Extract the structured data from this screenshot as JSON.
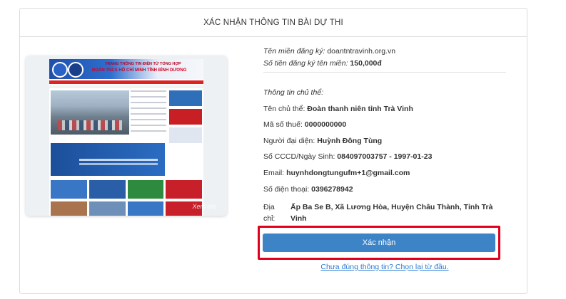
{
  "header": {
    "title": "XÁC NHẬN THÔNG TIN BÀI DỰ THI"
  },
  "preview": {
    "banner_line1": "TRANG THÔNG TIN ĐIỆN TỬ TỔNG HỢP",
    "banner_line2": "ĐOÀN TNCS HỒ CHÍ MINH TỈNH BÌNH DƯƠNG",
    "watermark": "Xem chi"
  },
  "domain": {
    "registered_label": "Tên miền đăng ký:",
    "registered_value": "doantntravinh.org.vn",
    "fee_label": "Số tiền đăng ký tên miền:",
    "fee_value": "150,000đ"
  },
  "owner": {
    "section_label": "Thông tin chủ thể:",
    "name_label": "Tên chủ thể:",
    "name_value": "Đoàn thanh niên tỉnh Trà Vinh",
    "tax_label": "Mã số thuế:",
    "tax_value": "0000000000",
    "rep_label": "Người đại diện:",
    "rep_value": "Huỳnh Đông Tùng",
    "id_label": "Số CCCD/Ngày Sinh:",
    "id_value": "084097003757 - 1997-01-23",
    "email_label": "Email:",
    "email_value": "huynhdongtungufm+1@gmail.com",
    "phone_label": "Số điện thoại:",
    "phone_value": "0396278942",
    "address_label": "Địa chỉ:",
    "address_value": "Ấp Ba Se B, Xã Lương Hòa, Huyện Châu Thành, Tỉnh Trà Vinh"
  },
  "actions": {
    "confirm_label": "Xác nhận",
    "back_link": "Chưa đúng thông tin? Chọn lại từ đầu."
  },
  "colors": {
    "button": "#3d84c6",
    "highlight": "#e0001b",
    "link": "#2a7bd4"
  }
}
